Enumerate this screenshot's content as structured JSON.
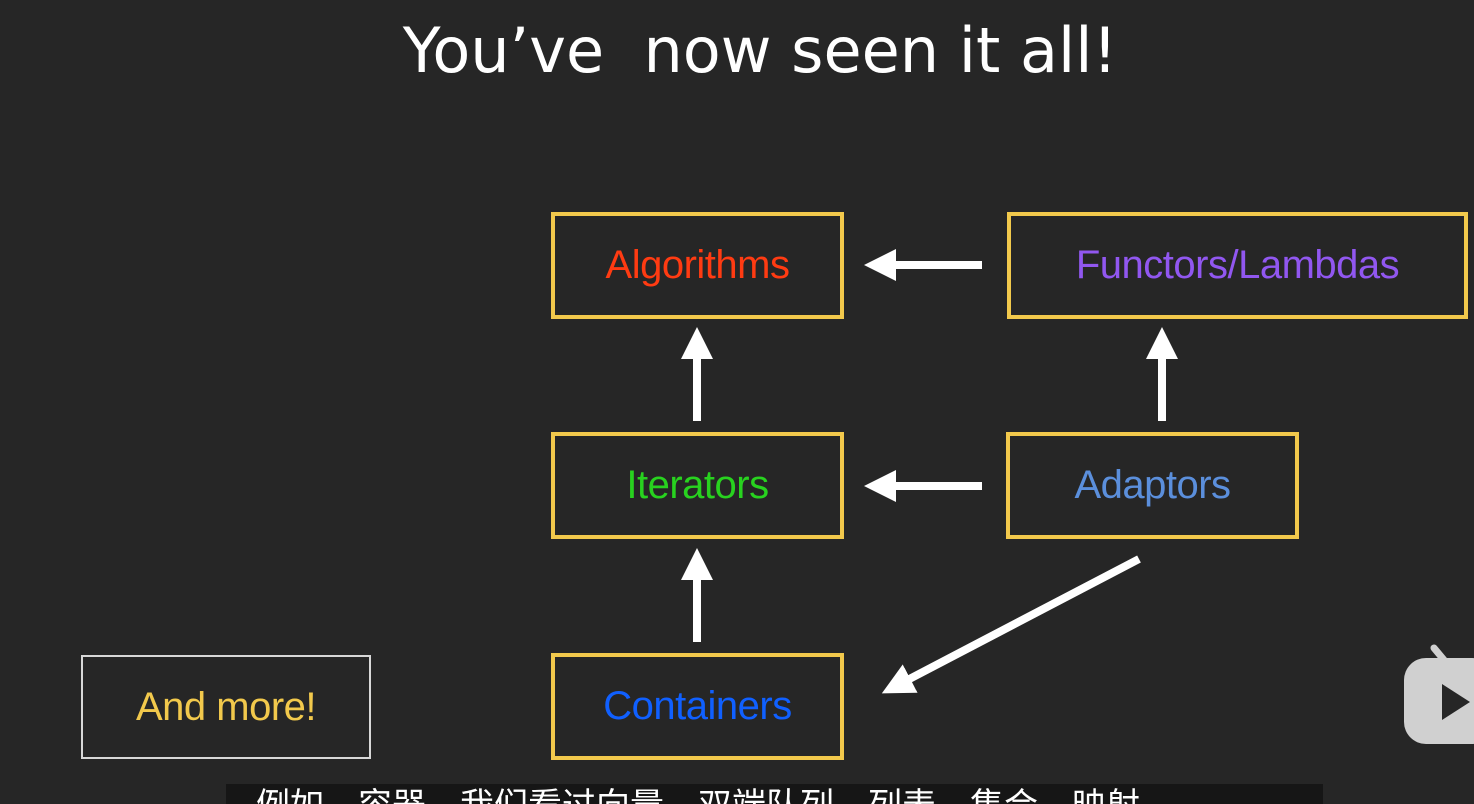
{
  "slide": {
    "title": "You’ve  now seen it all!"
  },
  "boxes": {
    "algorithms": "Algorithms",
    "functors": "Functors/Lambdas",
    "iterators": "Iterators",
    "adaptors": "Adaptors",
    "containers": "Containers",
    "more": "And more!"
  },
  "colors": {
    "background": "#262626",
    "box_border": "#f2c94c",
    "algorithms": "#ff3b12",
    "functors": "#9157f0",
    "iterators": "#28d21f",
    "adaptors": "#5b8fdc",
    "containers": "#1060ff",
    "more": "#f2c94c",
    "arrows": "#ffffff"
  },
  "arrows": [
    {
      "from": "functors",
      "to": "algorithms"
    },
    {
      "from": "iterators",
      "to": "algorithms"
    },
    {
      "from": "adaptors",
      "to": "functors"
    },
    {
      "from": "adaptors",
      "to": "iterators"
    },
    {
      "from": "containers",
      "to": "iterators"
    },
    {
      "from": "adaptors",
      "to": "containers"
    }
  ],
  "subtitle": {
    "text": "例如，容器，我们看过向量，双端队列，列表，集合，映射"
  },
  "overlay": {
    "logo_icon": "bilibili-tv-icon"
  }
}
